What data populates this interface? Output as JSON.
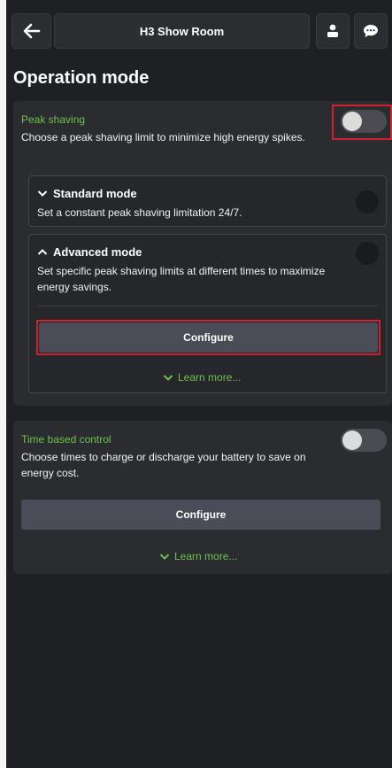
{
  "header": {
    "title": "H3 Show Room"
  },
  "section_title": "Operation mode",
  "peak_shaving": {
    "label": "Peak shaving",
    "description": "Choose a peak shaving limit to minimize high energy spikes.",
    "toggle_on": false,
    "standard_mode": {
      "title": "Standard mode",
      "description": "Set a constant peak shaving limitation 24/7."
    },
    "advanced_mode": {
      "title": "Advanced mode",
      "description": "Set specific peak shaving limits at different times to maximize energy savings.",
      "configure_label": "Configure",
      "learn_more": "Learn more..."
    }
  },
  "time_based": {
    "label": "Time based control",
    "description": "Choose times to charge or discharge your battery to save on energy cost.",
    "toggle_on": false,
    "configure_label": "Configure",
    "learn_more": "Learn more..."
  },
  "colors": {
    "accent_green": "#6cc24a",
    "highlight_red": "#d0212f",
    "background": "#1f2024"
  }
}
